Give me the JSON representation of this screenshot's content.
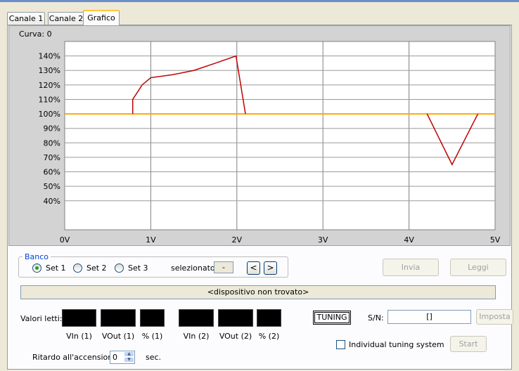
{
  "tabs": [
    {
      "label": "Canale 1",
      "active": false
    },
    {
      "label": "Canale 2",
      "active": false
    },
    {
      "label": "Grafico",
      "active": true
    }
  ],
  "chart_data": {
    "type": "line",
    "title": "Curva: 0",
    "x_unit": "V",
    "xlim": [
      0,
      5
    ],
    "ylim": [
      20,
      150
    ],
    "x_ticks": [
      "0V",
      "1V",
      "2V",
      "3V",
      "4V",
      "5V"
    ],
    "y_ticks": [
      "40%",
      "50%",
      "60%",
      "70%",
      "80%",
      "90%",
      "100%",
      "110%",
      "120%",
      "130%",
      "140%"
    ],
    "y_tick_values": [
      40,
      50,
      60,
      70,
      80,
      90,
      100,
      110,
      120,
      130,
      140
    ],
    "grid": true,
    "series": [
      {
        "color": "#ffaa00",
        "points": [
          [
            0,
            100
          ],
          [
            5,
            100
          ]
        ]
      },
      {
        "color": "#c00000",
        "points": [
          [
            0.79,
            100
          ],
          [
            0.79,
            110
          ],
          [
            0.9,
            120
          ],
          [
            1.0,
            125
          ],
          [
            1.25,
            127
          ],
          [
            1.5,
            130
          ],
          [
            1.75,
            135
          ],
          [
            1.99,
            140
          ],
          [
            2.1,
            100
          ]
        ]
      },
      {
        "color": "#c00000",
        "points": [
          [
            4.21,
            100
          ],
          [
            4.5,
            65
          ],
          [
            4.8,
            100
          ]
        ]
      }
    ]
  },
  "banco": {
    "legend": "Banco",
    "options": [
      {
        "label": "Set 1",
        "checked": true
      },
      {
        "label": "Set 2",
        "checked": false
      },
      {
        "label": "Set 3",
        "checked": false
      }
    ],
    "selected_label": "selezionato:",
    "selected_value": "-",
    "prev_icon": "chevron-left",
    "next_icon": "chevron-right",
    "prev_glyph": "<",
    "next_glyph": ">"
  },
  "buttons": {
    "invia": "Invia",
    "leggi": "Leggi",
    "imposta": "Imposta",
    "start": "Start"
  },
  "status_message": "<dispositivo non trovato>",
  "readings": {
    "label": "Valori letti:",
    "boxes": [
      "VIn (1)",
      "VOut (1)",
      "% (1)",
      "VIn (2)",
      "VOut (2)",
      "% (2)"
    ]
  },
  "tuning": {
    "label": "TUNING",
    "sn_label": "S/N:",
    "sn_value": "[]",
    "individual_label": "Individual tuning system",
    "individual_checked": false
  },
  "delay": {
    "label": "Ritardo all'accensione:",
    "value": "0",
    "unit": "sec."
  },
  "colors": {
    "window_bg": "#ece9d8",
    "chart_bg": "#ffffff",
    "reference_line": "#ffaa00",
    "curve": "#c00000",
    "groupbox_legend": "#0046d5"
  }
}
